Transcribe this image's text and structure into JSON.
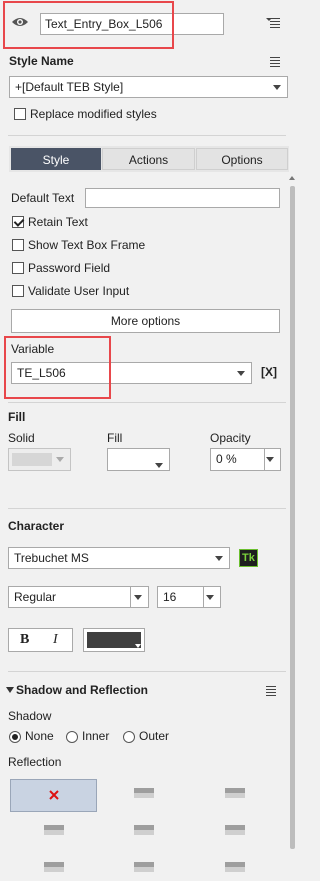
{
  "header": {
    "object_name": "Text_Entry_Box_L506"
  },
  "style_name": {
    "label": "Style Name",
    "value": "+[Default TEB Style]",
    "replace_label": "Replace modified styles"
  },
  "tabs": [
    {
      "label": "Style"
    },
    {
      "label": "Actions"
    },
    {
      "label": "Options"
    }
  ],
  "options": {
    "default_text_label": "Default Text",
    "default_text_value": "",
    "retain_text": "Retain Text",
    "show_frame": "Show Text Box Frame",
    "password": "Password Field",
    "validate": "Validate User Input",
    "more_options": "More options"
  },
  "variable": {
    "label": "Variable",
    "value": "TE_L506",
    "clear_glyph": "[X]"
  },
  "fill": {
    "title": "Fill",
    "solid_label": "Solid",
    "fill_label": "Fill",
    "opacity_label": "Opacity",
    "opacity_value": "0 %",
    "solid_color": "#d6d6d6"
  },
  "character": {
    "title": "Character",
    "font": "Trebuchet MS",
    "tk_label": "Tk",
    "style": "Regular",
    "size": "16",
    "bold_label": "B",
    "italic_label": "I",
    "text_color": "#404040"
  },
  "shadow": {
    "title": "Shadow and Reflection",
    "shadow_label": "Shadow",
    "none": "None",
    "inner": "Inner",
    "outer": "Outer",
    "reflection_label": "Reflection"
  },
  "colors": {
    "highlight": "#e8474b",
    "active_tab": "#4a5466",
    "tk_bg": "#1e1e1e",
    "tk_fg": "#7ad13b"
  }
}
